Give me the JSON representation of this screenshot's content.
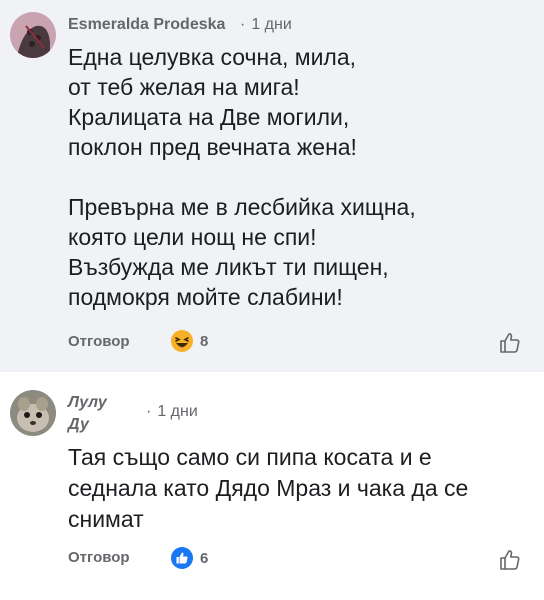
{
  "comments": [
    {
      "author": "Esmeralda Prodeska",
      "time": "1 дни",
      "separator": "·",
      "text": "Една целувка сочна, мила,\nот теб желая на мига!\nКралицата на Две могили,\nпоклон пред вечната жена!\n\nПревърна ме в лесбийка хищна,\nкоято цели нощ не спи!\nВъзбужда ме ликът ти пищен,\nподмокря мойте слабини!",
      "reply_label": "Отговор",
      "reaction_icon": "haha-emoji-icon",
      "reaction_count": "8"
    },
    {
      "author": "Лулу Ду",
      "time": "1 дни",
      "separator": "·",
      "text": "Тая също само си пипа косата и е\nседнала като Дядо Мраз и чака да се\nснимат",
      "reply_label": "Отговор",
      "reaction_icon": "like-icon",
      "reaction_count": "6"
    }
  ],
  "colors": {
    "highlight_bg": "#f0f2f5",
    "meta": "#65676b",
    "like_blue": "#1877f2",
    "haha_yellow": "#f7b125"
  }
}
